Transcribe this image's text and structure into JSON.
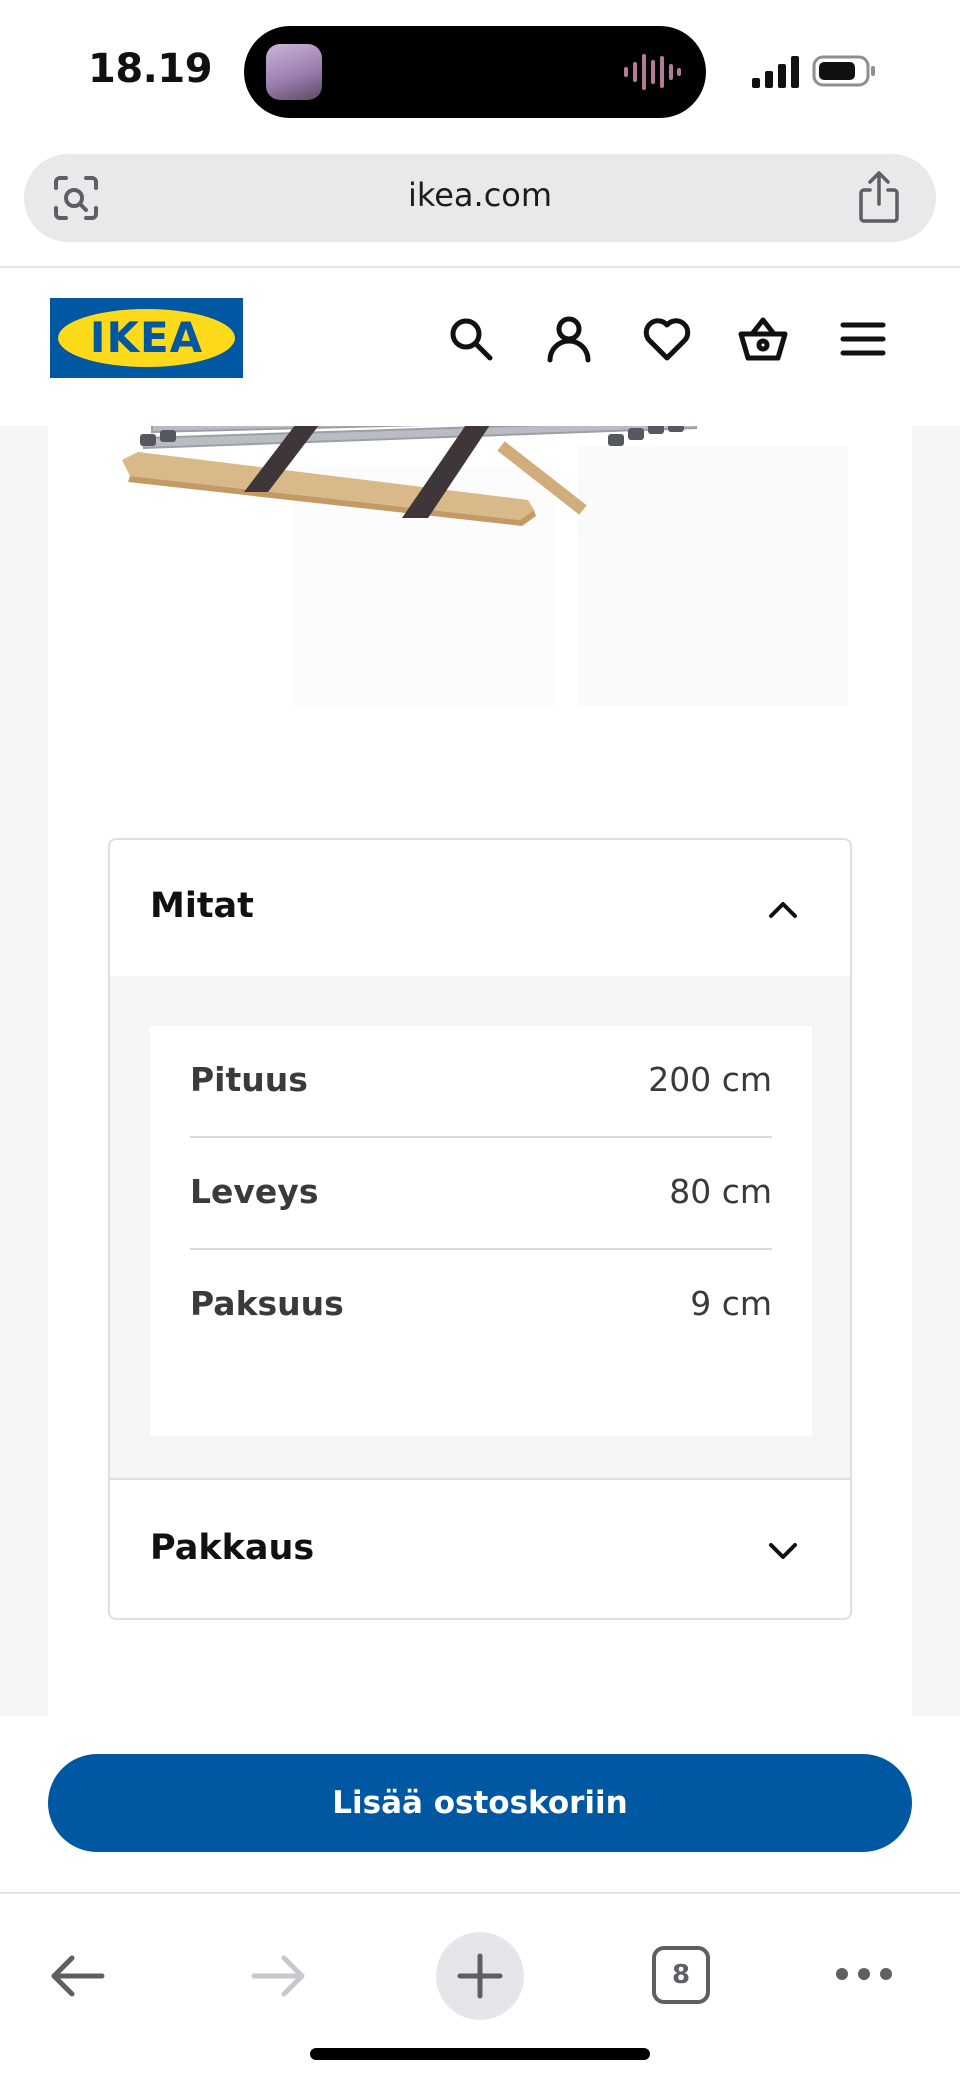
{
  "status_bar": {
    "time": "18.19"
  },
  "browser": {
    "url": "ikea.com",
    "tab_count": "8"
  },
  "header": {
    "logo_text": "IKEA",
    "icons": [
      "search-icon",
      "account-icon",
      "heart-icon",
      "basket-icon",
      "menu-icon"
    ]
  },
  "dimensions_section": {
    "title": "Mitat",
    "expanded": true,
    "rows": [
      {
        "label": "Pituus",
        "value": "200 cm"
      },
      {
        "label": "Leveys",
        "value": "80 cm"
      },
      {
        "label": "Paksuus",
        "value": "9 cm"
      }
    ]
  },
  "package_section": {
    "title": "Pakkaus",
    "expanded": false
  },
  "cart": {
    "button_label": "Lisää ostoskoriin"
  },
  "colors": {
    "ikea_blue": "#0058a3",
    "ikea_yellow": "#ffda1a",
    "panel_gray": "#f5f5f5"
  }
}
